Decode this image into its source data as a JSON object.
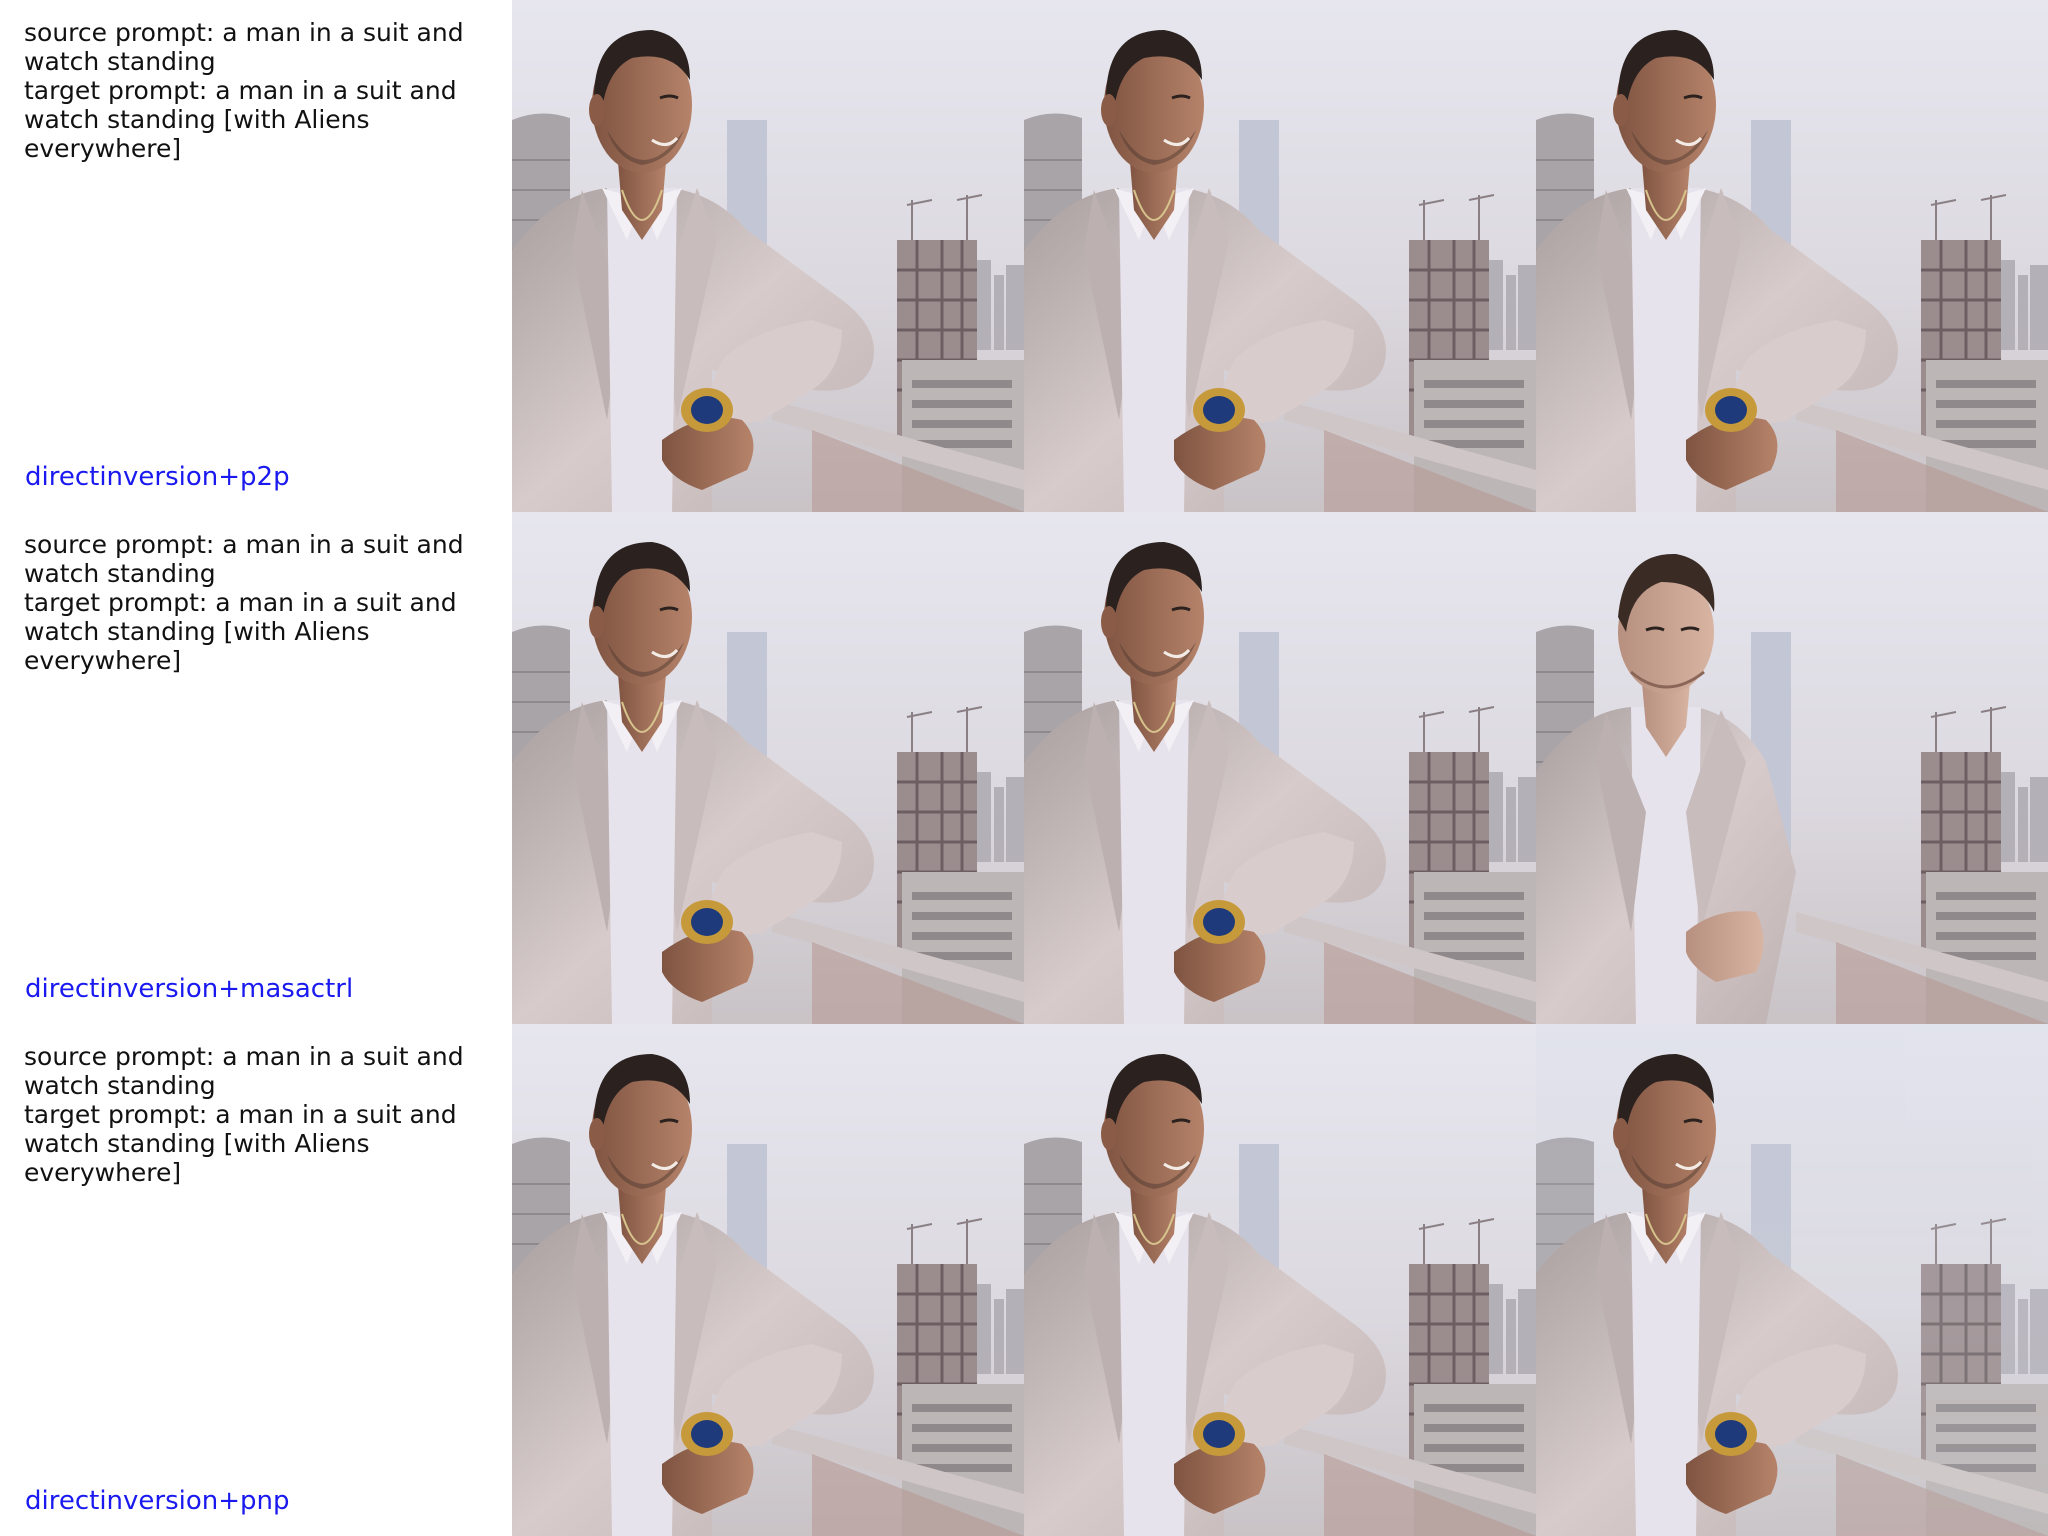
{
  "rows": [
    {
      "prompt_text": "source prompt: a man in a suit and\nwatch standing\ntarget prompt: a man in a suit and\nwatch standing [with Aliens\neverywhere]",
      "method": "directinversion+p2p",
      "method_color": "#1a1af0"
    },
    {
      "prompt_text": "source prompt: a man in a suit and\nwatch standing\ntarget prompt: a man in a suit and\nwatch standing [with Aliens\neverywhere]",
      "method": "directinversion+masactrl",
      "method_color": "#1a1af0"
    },
    {
      "prompt_text": "source prompt: a man in a suit and\nwatch standing\ntarget prompt: a man in a suit and\nwatch standing [with Aliens\neverywhere]",
      "method": "directinversion+pnp",
      "method_color": "#1a1af0"
    }
  ],
  "colors": {
    "sky": "#dfe0e8",
    "suit": "#cfc3c3",
    "skin": "#9a6b52",
    "hair": "#2b2220",
    "shirt": "#e8e6ee",
    "watch_gold": "#c69a3a",
    "watch_face": "#1f3a7a",
    "building": "#a7a3a8",
    "railing": "#c9c2c2"
  }
}
